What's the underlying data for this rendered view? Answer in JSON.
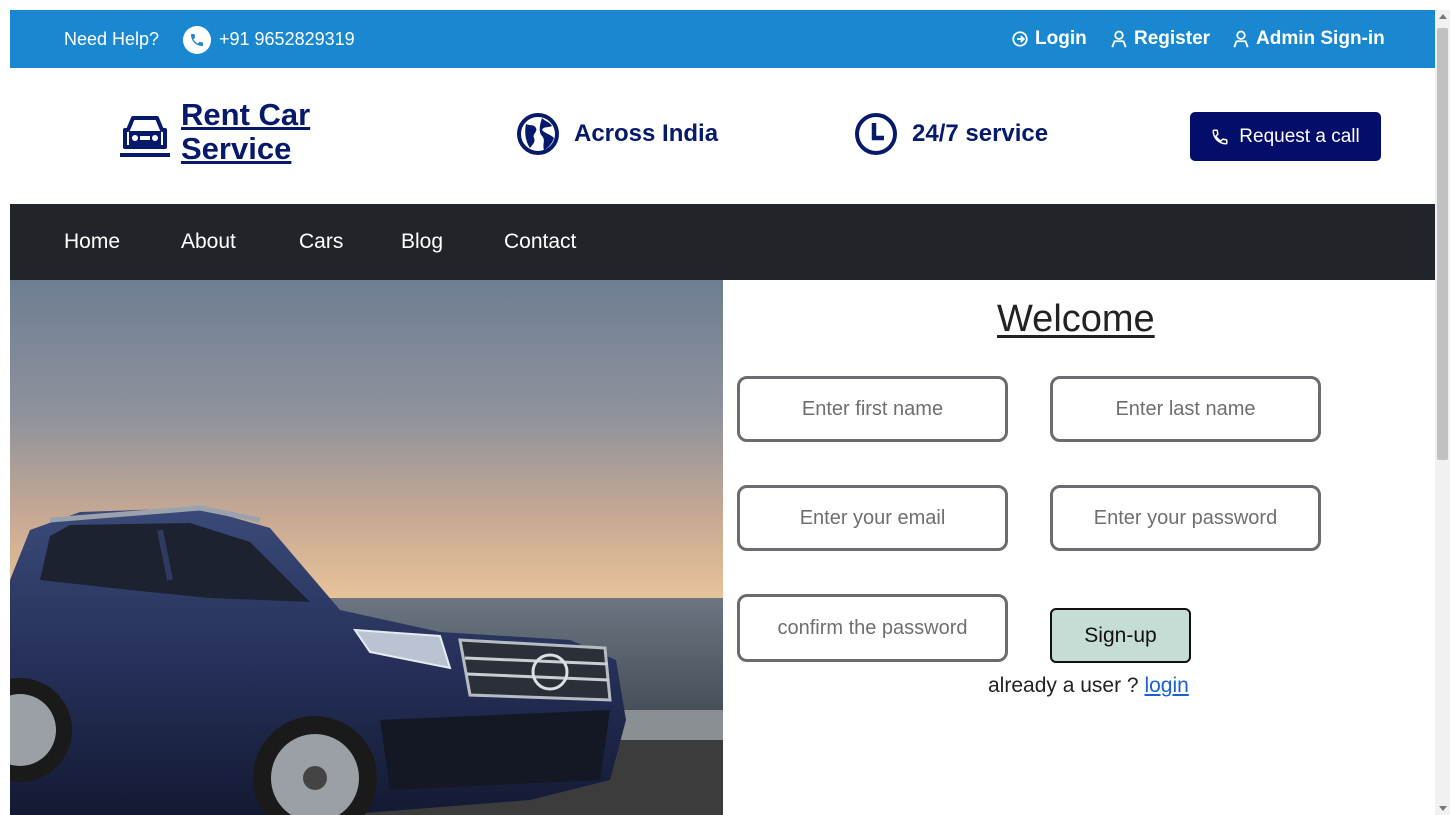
{
  "topbar": {
    "help_label": "Need Help?",
    "phone": "+91 9652829319",
    "login": "Login",
    "register": "Register",
    "admin": "Admin Sign-in"
  },
  "header": {
    "brand_line1": "Rent Car",
    "brand_line2": "Service",
    "feature1": "Across India",
    "feature2": "24/7 service",
    "request_call": "Request a call"
  },
  "nav": {
    "items": [
      "Home",
      "About",
      "Cars",
      "Blog",
      "Contact"
    ]
  },
  "form": {
    "title": "Welcome",
    "first_name_placeholder": "Enter first name",
    "last_name_placeholder": "Enter last name",
    "email_placeholder": "Enter your email",
    "password_placeholder": "Enter your password",
    "confirm_placeholder": "confirm the password",
    "signup_label": "Sign-up",
    "already_text": "already a user ?",
    "login_link": "login"
  },
  "colors": {
    "topbar": "#1a88d0",
    "brand": "#06196b",
    "button_dark": "#030d6a",
    "nav_bg": "#212529",
    "signup_bg": "#c6ddd6"
  },
  "icons": [
    "phone-icon",
    "login-icon",
    "user-icon",
    "car-icon",
    "globe-icon",
    "clock-icon"
  ]
}
